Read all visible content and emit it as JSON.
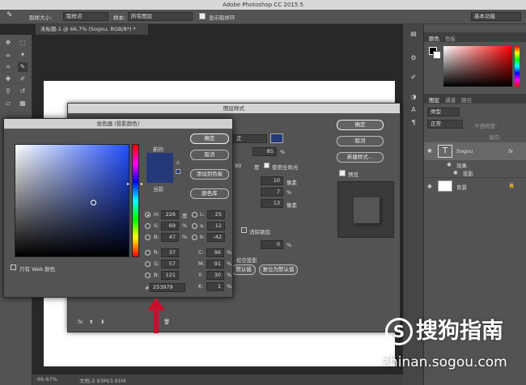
{
  "app": {
    "title": "Adobe Photoshop CC 2015.5"
  },
  "options_bar": {
    "sample_size_label": "取样大小:",
    "sample_size_value": "取样点",
    "sample_label": "样本:",
    "sample_value": "所有图层",
    "show_ring_label": "显示取样环",
    "workspace_value": "基本功能"
  },
  "document": {
    "tab_label": "未标题-1 @ 66.7% (Sogou, RGB/8*) *"
  },
  "status_bar": {
    "zoom": "66.67%",
    "doc_info": "文档:2.93M/3.91M"
  },
  "panels": {
    "color_tabs": [
      "颜色",
      "色板"
    ],
    "layers_tabs": [
      "图层",
      "通道",
      "路径"
    ],
    "layers_kind_label": "类型",
    "blend_mode_value": "正常",
    "opacity_label": "不透明度:",
    "fill_label": "填充:",
    "layers": [
      {
        "name": "Sogou",
        "thumb": "T",
        "fx": "fx"
      },
      {
        "name": "效果"
      },
      {
        "name": "投影"
      },
      {
        "name": "背景"
      }
    ]
  },
  "layer_style_dialog": {
    "title": "图层样式",
    "ok_label": "确定",
    "cancel_label": "取消",
    "new_style_label": "新建样式...",
    "preview_label": "预览",
    "blend_value": "正",
    "opacity_value": "85",
    "percent": "%",
    "angle_value": "90",
    "angle_unit": "度",
    "global_light_label": "使用全局光",
    "distance_value": "10",
    "spread_value": "7",
    "size_value": "13",
    "px_unit": "像素",
    "anti_alias_label": "消除锯齿",
    "noise_value": "0",
    "knockout_label": "挖空投影",
    "default_btn_label": "默认值",
    "reset_btn_label": "复位为默认值",
    "fx_label": "fx."
  },
  "color_picker": {
    "title": "拾色器 (投影颜色)",
    "ok_label": "确定",
    "cancel_label": "取消",
    "add_swatch_label": "添加到色板",
    "libraries_label": "颜色库",
    "new_label": "新的",
    "current_label": "当前",
    "web_only_label": "只有 Web 颜色",
    "hex_label": "#",
    "hex_value": "253979",
    "new_color": "#253979",
    "current_color": "#253979",
    "hsb": [
      {
        "label": "H:",
        "value": "226",
        "unit": "度"
      },
      {
        "label": "S:",
        "value": "69",
        "unit": "%"
      },
      {
        "label": "B:",
        "value": "47",
        "unit": "%"
      }
    ],
    "rgb": [
      {
        "label": "R:",
        "value": "37"
      },
      {
        "label": "G:",
        "value": "57"
      },
      {
        "label": "B:",
        "value": "121"
      }
    ],
    "lab": [
      {
        "label": "L:",
        "value": "25"
      },
      {
        "label": "a:",
        "value": "12"
      },
      {
        "label": "b:",
        "value": "-42"
      }
    ],
    "cmyk": [
      {
        "label": "C:",
        "value": "96",
        "unit": "%"
      },
      {
        "label": "M:",
        "value": "91",
        "unit": "%"
      },
      {
        "label": "Y:",
        "value": "30",
        "unit": "%"
      },
      {
        "label": "K:",
        "value": "1",
        "unit": "%"
      }
    ]
  },
  "watermark": {
    "brand": "搜狗指南",
    "url": "zhinan.sogou.com"
  },
  "colors": {
    "accent_arrow": "#c8102e"
  }
}
